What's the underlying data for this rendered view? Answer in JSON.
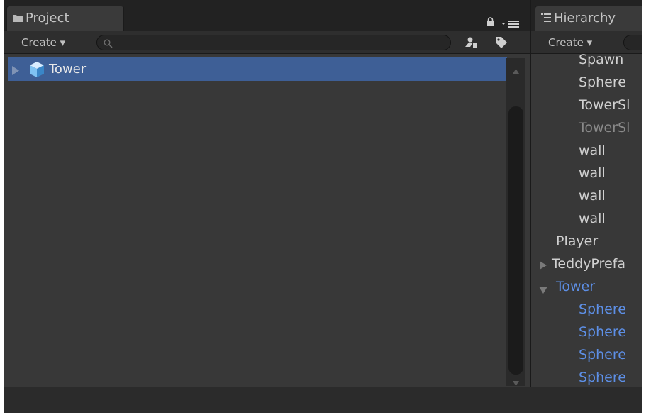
{
  "project_panel": {
    "tab_label": "Project",
    "create_label": "Create ▾",
    "search_placeholder": "",
    "selected_item": "Tower"
  },
  "hierarchy_panel": {
    "tab_label": "Hierarchy",
    "create_label": "Create ▾",
    "items": [
      {
        "label": "Spawn"
      },
      {
        "label": "Sphere"
      },
      {
        "label": "TowerSl"
      },
      {
        "label": "TowerSl"
      },
      {
        "label": "wall"
      },
      {
        "label": "wall"
      },
      {
        "label": "wall"
      },
      {
        "label": "wall"
      },
      {
        "label": "Player"
      },
      {
        "label": "TeddyPrefa"
      },
      {
        "label": "Tower"
      },
      {
        "label": "Sphere"
      },
      {
        "label": "Sphere"
      },
      {
        "label": "Sphere"
      },
      {
        "label": "Sphere"
      }
    ]
  },
  "colors": {
    "selection": "#3e5f96",
    "panel_bg": "#383838",
    "text": "#d0d0d0",
    "text_dim": "#8a8a8a",
    "text_highlight": "#5d8fe6"
  },
  "icons": [
    "folder-icon",
    "lock-icon",
    "menu-icon",
    "search-icon",
    "filter-type-icon",
    "tag-icon",
    "expand-arrow-icon",
    "prefab-cube-icon",
    "hierarchy-icon"
  ]
}
